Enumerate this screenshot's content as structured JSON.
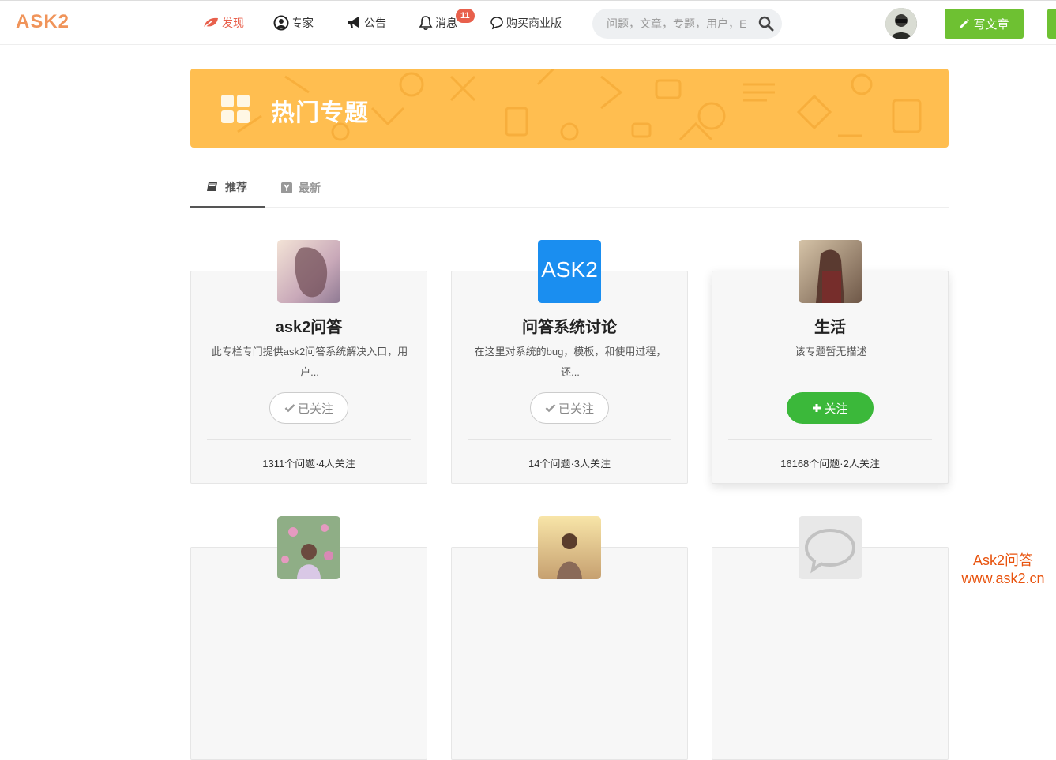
{
  "header": {
    "logo": "ASK2",
    "nav": [
      {
        "label": "发现",
        "icon": "leaf-icon",
        "active": true
      },
      {
        "label": "专家",
        "icon": "user-circle-icon",
        "active": false
      },
      {
        "label": "公告",
        "icon": "megaphone-icon",
        "active": false
      },
      {
        "label": "消息",
        "icon": "bell-icon",
        "active": false,
        "badge": "11"
      },
      {
        "label": "购买商业版",
        "icon": "speech-bubble-icon",
        "active": false
      }
    ],
    "search_placeholder": "问题，文章，专题，用户，E",
    "write_label": "写文章"
  },
  "banner": {
    "title": "热门专题",
    "color": "#ffbe50"
  },
  "tabs": [
    {
      "label": "推荐",
      "icon": "book-icon",
      "active": true
    },
    {
      "label": "最新",
      "icon": "y-icon",
      "active": false
    }
  ],
  "topics": [
    {
      "title": "ask2问答",
      "desc": "此专栏专门提供ask2问答系统解决入口，用户...",
      "button": "已关注",
      "followed": true,
      "stats": "1311个问题·4人关注"
    },
    {
      "title": "问答系统讨论",
      "desc": "在这里对系统的bug，模板，和使用过程，还...",
      "button": "已关注",
      "followed": true,
      "stats": "14个问题·3人关注",
      "avatar_text": "ASK2"
    },
    {
      "title": "生活",
      "desc": "该专题暂无描述",
      "button": "关注",
      "followed": false,
      "stats": "16168个问题·2人关注"
    }
  ],
  "watermark": {
    "line1": "Ask2问答",
    "line2": "www.ask2.cn"
  },
  "colors": {
    "accent": "#e8604c",
    "green": "#6ec132",
    "follow_green": "#3bb83a",
    "logo": "#f0945a"
  }
}
